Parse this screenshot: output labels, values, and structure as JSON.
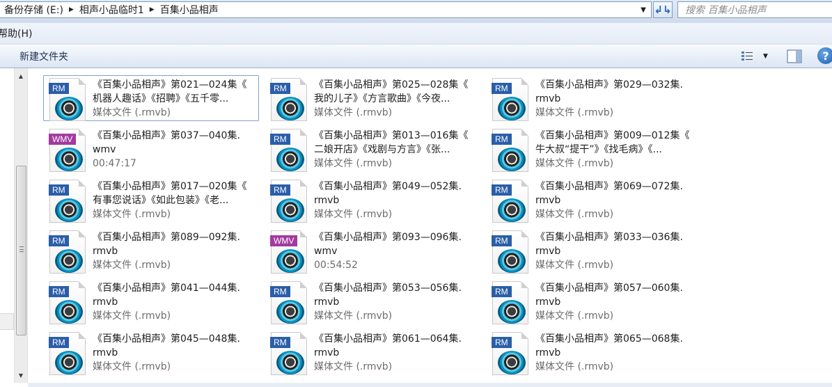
{
  "address_bar": {
    "crumbs": [
      "备份存储 (E:)",
      "相声小品临时1",
      "百集小品相声"
    ],
    "search_placeholder": "搜索 百集小品相声"
  },
  "menu": {
    "help_label": "帮助(H)"
  },
  "toolbar": {
    "new_folder_label": "新建文件夹"
  },
  "icons": {
    "rm_badge": "RM",
    "wmv_badge": "WMV"
  },
  "files": [
    {
      "line1": "《百集小品相声》第021—024集《",
      "line2": "机器人趣话》《招聘》《五千零...",
      "line3": "媒体文件 (.rmvb)",
      "type": "rm",
      "selected": true
    },
    {
      "line1": "《百集小品相声》第025—028集《",
      "line2": "我的儿子》《方言歌曲》《今夜...",
      "line3": "媒体文件 (.rmvb)",
      "type": "rm"
    },
    {
      "line1": "《百集小品相声》第029—032集.",
      "line2": "rmvb",
      "line3": "媒体文件 (.rmvb)",
      "type": "rm"
    },
    {
      "line1": "《百集小品相声》第037—040集.",
      "line2": "wmv",
      "line3": "00:47:17",
      "type": "wmv"
    },
    {
      "line1": "《百集小品相声》第013—016集《",
      "line2": "二娘开店》《戏剧与方言》《张...",
      "line3": "媒体文件 (.rmvb)",
      "type": "rm"
    },
    {
      "line1": "《百集小品相声》第009—012集《",
      "line2": "牛大叔“提干”》《找毛病》《...",
      "line3": "媒体文件 (.rmvb)",
      "type": "rm"
    },
    {
      "line1": "《百集小品相声》第017—020集《",
      "line2": "有事您说话》《如此包装》《老...",
      "line3": "媒体文件 (.rmvb)",
      "type": "rm"
    },
    {
      "line1": "《百集小品相声》第049—052集.",
      "line2": "rmvb",
      "line3": "媒体文件 (.rmvb)",
      "type": "rm"
    },
    {
      "line1": "《百集小品相声》第069—072集.",
      "line2": "rmvb",
      "line3": "媒体文件 (.rmvb)",
      "type": "rm"
    },
    {
      "line1": "《百集小品相声》第089—092集.",
      "line2": "rmvb",
      "line3": "媒体文件 (.rmvb)",
      "type": "rm"
    },
    {
      "line1": "《百集小品相声》第093—096集.",
      "line2": "wmv",
      "line3": "00:54:52",
      "type": "wmv"
    },
    {
      "line1": "《百集小品相声》第033—036集.",
      "line2": "rmvb",
      "line3": "媒体文件 (.rmvb)",
      "type": "rm"
    },
    {
      "line1": "《百集小品相声》第041—044集.",
      "line2": "rmvb",
      "line3": "媒体文件 (.rmvb)",
      "type": "rm"
    },
    {
      "line1": "《百集小品相声》第053—056集.",
      "line2": "rmvb",
      "line3": "媒体文件 (.rmvb)",
      "type": "rm"
    },
    {
      "line1": "《百集小品相声》第057—060集.",
      "line2": "rmvb",
      "line3": "媒体文件 (.rmvb)",
      "type": "rm"
    },
    {
      "line1": "《百集小品相声》第045—048集.",
      "line2": "rmvb",
      "line3": "媒体文件 (.rmvb)",
      "type": "rm"
    },
    {
      "line1": "《百集小品相声》第061—064集.",
      "line2": "rmvb",
      "line3": "媒体文件 (.rmvb)",
      "type": "rm"
    },
    {
      "line1": "《百集小品相声》第065—068集.",
      "line2": "rmvb",
      "line3": "媒体文件 (.rmvb)",
      "type": "rm"
    }
  ]
}
